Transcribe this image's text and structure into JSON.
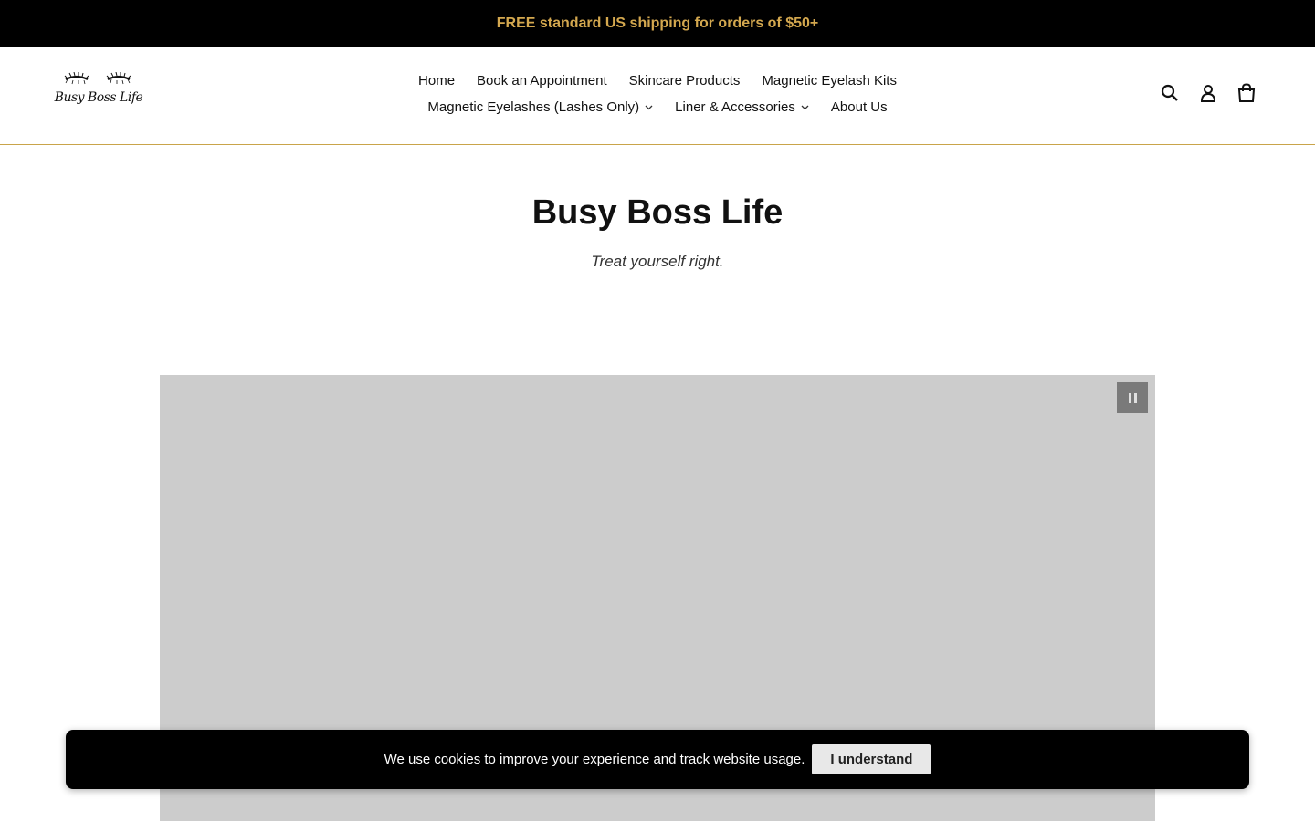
{
  "announcement": {
    "text": "FREE standard US shipping for orders of $50+",
    "color": "#d4a84f"
  },
  "logo": {
    "text": "Busy Boss Life"
  },
  "nav": {
    "row1": [
      {
        "label": "Home",
        "active": true
      },
      {
        "label": "Book an Appointment"
      },
      {
        "label": "Skincare Products"
      },
      {
        "label": "Magnetic Eyelash Kits"
      }
    ],
    "row2": [
      {
        "label": "Magnetic Eyelashes (Lashes Only)",
        "dropdown": true
      },
      {
        "label": "Liner & Accessories",
        "dropdown": true
      },
      {
        "label": "About Us"
      }
    ]
  },
  "header_icons": [
    "search-icon",
    "account-icon",
    "cart-icon"
  ],
  "hero": {
    "title": "Busy Boss Life",
    "subtitle": "Treat yourself right."
  },
  "video": {
    "control_icon": "pause-icon"
  },
  "cookie_banner": {
    "text": "We use cookies to improve your experience and track website usage.",
    "button_label": "I understand"
  },
  "colors": {
    "accent": "#c9a44a",
    "video_placeholder": "#cccccc"
  }
}
